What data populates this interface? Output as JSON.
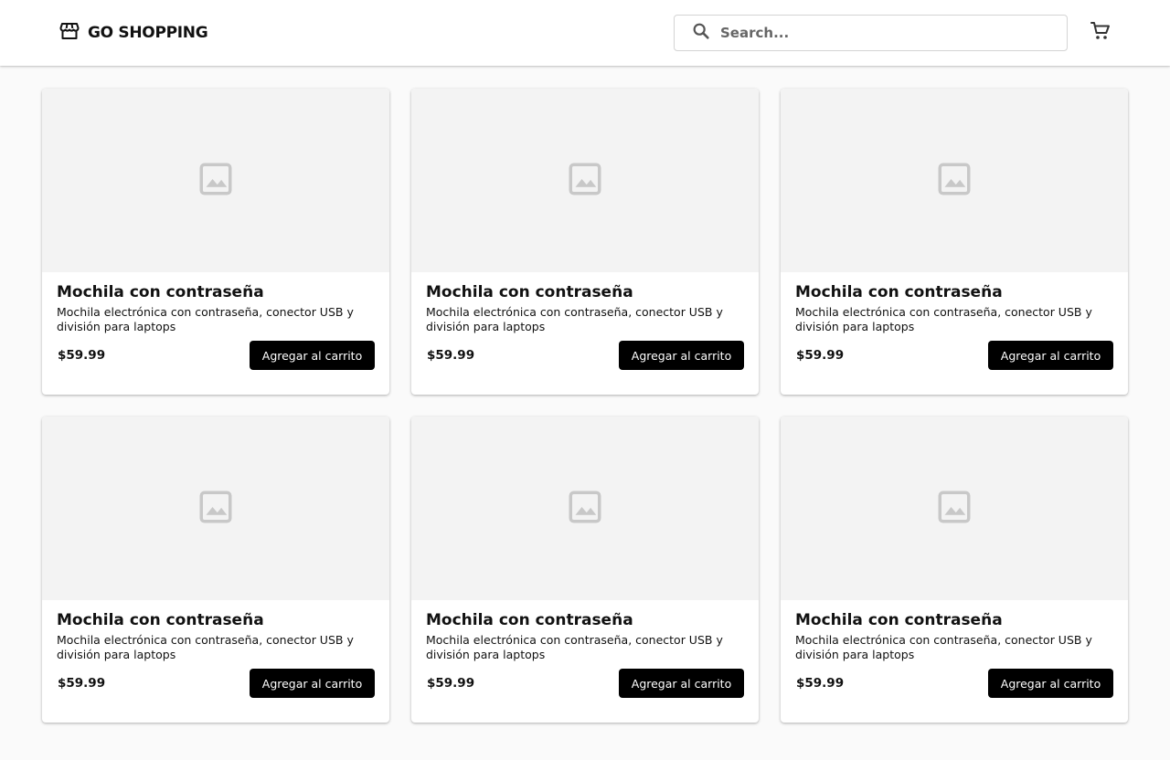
{
  "header": {
    "brand": "GO SHOPPING",
    "brand_icon": "storefront-icon",
    "search": {
      "placeholder": "Search...",
      "value": "",
      "icon": "search-icon"
    },
    "cart_icon": "shopping-cart-icon"
  },
  "colors": {
    "accent": "#000000",
    "header_bg": "#ffffff",
    "page_bg": "#fafafa",
    "image_placeholder_bg": "#f3f3f3",
    "image_icon": "#c8c8c8"
  },
  "products": [
    {
      "title": "Mochila con contraseña",
      "description": "Mochila electrónica con contraseña, conector USB y división para laptops",
      "price": "$59.99",
      "button_label": "Agregar al carrito",
      "image_icon": "image-placeholder-icon"
    },
    {
      "title": "Mochila con contraseña",
      "description": "Mochila electrónica con contraseña, conector USB y división para laptops",
      "price": "$59.99",
      "button_label": "Agregar al carrito",
      "image_icon": "image-placeholder-icon"
    },
    {
      "title": "Mochila con contraseña",
      "description": "Mochila electrónica con contraseña, conector USB y división para laptops",
      "price": "$59.99",
      "button_label": "Agregar al carrito",
      "image_icon": "image-placeholder-icon"
    },
    {
      "title": "Mochila con contraseña",
      "description": "Mochila electrónica con contraseña, conector USB y división para laptops",
      "price": "$59.99",
      "button_label": "Agregar al carrito",
      "image_icon": "image-placeholder-icon"
    },
    {
      "title": "Mochila con contraseña",
      "description": "Mochila electrónica con contraseña, conector USB y división para laptops",
      "price": "$59.99",
      "button_label": "Agregar al carrito",
      "image_icon": "image-placeholder-icon"
    },
    {
      "title": "Mochila con contraseña",
      "description": "Mochila electrónica con contraseña, conector USB y división para laptops",
      "price": "$59.99",
      "button_label": "Agregar al carrito",
      "image_icon": "image-placeholder-icon"
    }
  ]
}
